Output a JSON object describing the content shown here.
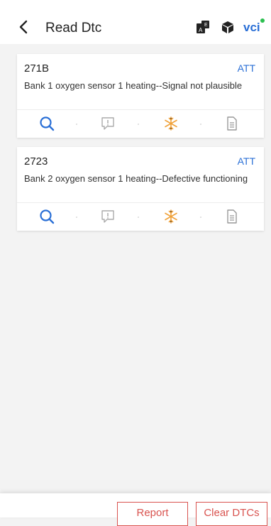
{
  "header": {
    "title": "Read Dtc",
    "vci_label": "vci"
  },
  "icons": {
    "back": "chevron-left-icon",
    "translate": "translate-icon",
    "box": "box-icon",
    "vci": "vci-icon"
  },
  "colors": {
    "accent_blue": "#2a6fd6",
    "freeze_orange": "#f0a23a",
    "button_red": "#d9534f"
  },
  "dtcs": [
    {
      "code": "271B",
      "status": "ATT",
      "description": "Bank 1 oxygen sensor 1 heating--Signal not plausible"
    },
    {
      "code": "2723",
      "status": "ATT",
      "description": "Bank 2 oxygen sensor 1 heating--Defective functioning"
    }
  ],
  "footer": {
    "report_label": "Report",
    "clear_label": "Clear DTCs"
  }
}
